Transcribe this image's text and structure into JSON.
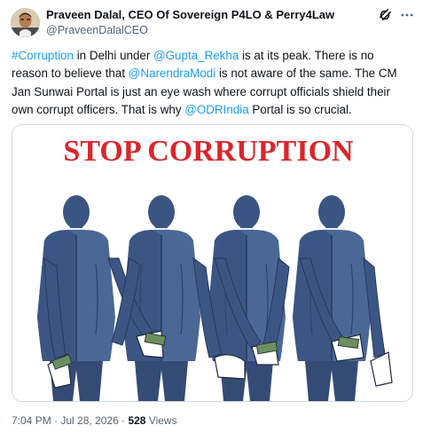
{
  "author": {
    "name": "Praveen Dalal, CEO Of Sovereign P4LO & Perry4Law",
    "handle": "@PraveenDalalCEO"
  },
  "tweet": {
    "segments": [
      {
        "text": "#Corruption",
        "link": true
      },
      {
        "text": " in Delhi under ",
        "link": false
      },
      {
        "text": "@Gupta_Rekha",
        "link": true
      },
      {
        "text": " is at its peak. There is no reason to believe that ",
        "link": false
      },
      {
        "text": "@NarendraModi",
        "link": true
      },
      {
        "text": " is not aware of the same. The CM Jan Sunwai Portal is just an eye wash where corrupt officials shield their own corrupt officers. That is why ",
        "link": false
      },
      {
        "text": "@ODRIndia",
        "link": true
      },
      {
        "text": " Portal is so crucial.",
        "link": false
      }
    ]
  },
  "image": {
    "headline": "STOP CORRUPTION",
    "headline_color": "#d9262c"
  },
  "meta": {
    "time": "7:04 PM",
    "separator1": " · ",
    "date": "Jul 28, 2026",
    "separator2": " · ",
    "views_count": "528",
    "views_label": " Views"
  },
  "icons": [
    "avatar",
    "grok-icon",
    "more-icon"
  ],
  "colors": {
    "link": "#1d9bf0",
    "secondary_text": "#536471",
    "suit": "#3f5a86"
  }
}
